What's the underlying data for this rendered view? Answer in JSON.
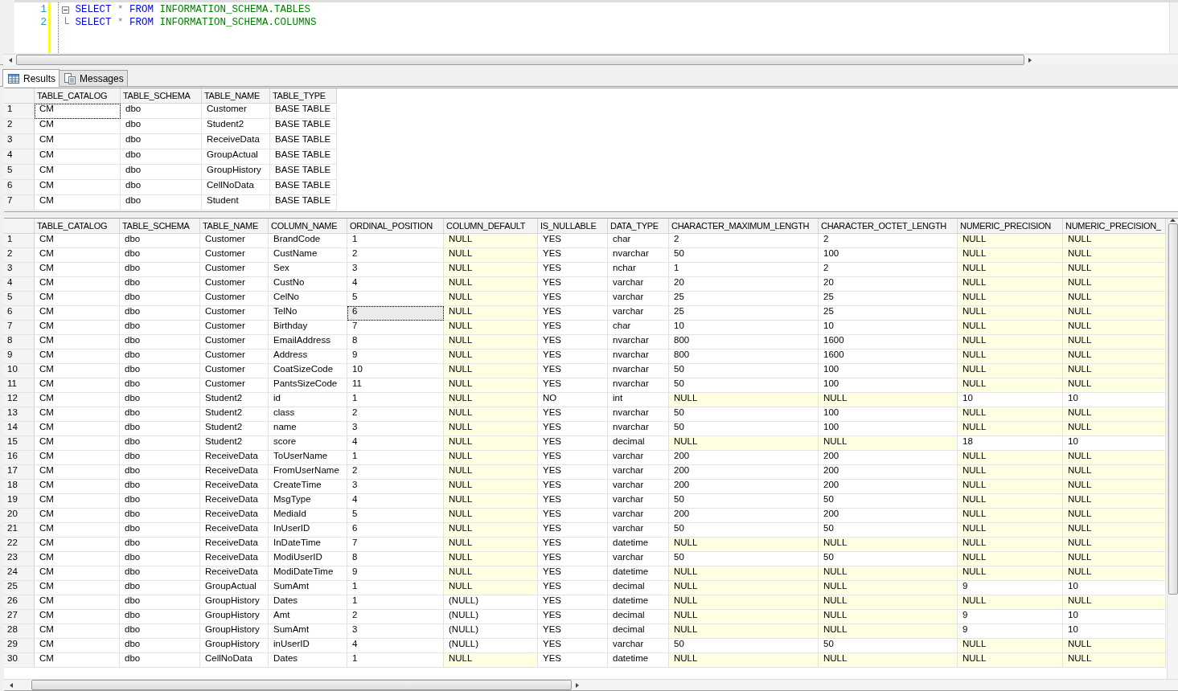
{
  "editor": {
    "lines": [
      {
        "number": "1",
        "fold_start": true,
        "tokens": [
          {
            "kind": "keyword",
            "text": "SELECT"
          },
          {
            "kind": "operator",
            "text": "*"
          },
          {
            "kind": "keyword",
            "text": "FROM"
          },
          {
            "kind": "identifier",
            "text": "INFORMATION_SCHEMA.TABLES"
          }
        ]
      },
      {
        "number": "2",
        "fold_start": false,
        "tokens": [
          {
            "kind": "keyword",
            "text": "SELECT"
          },
          {
            "kind": "operator",
            "text": "*"
          },
          {
            "kind": "keyword",
            "text": "FROM"
          },
          {
            "kind": "identifier",
            "text": "INFORMATION_SCHEMA.COLUMNS"
          }
        ]
      }
    ]
  },
  "tabs": [
    {
      "label": "Results",
      "kind": "grid",
      "selected": true
    },
    {
      "label": "Messages",
      "kind": "messages",
      "selected": false
    }
  ],
  "grids": [
    {
      "columns": [
        "TABLE_CATALOG",
        "TABLE_SCHEMA",
        "TABLE_NAME",
        "TABLE_TYPE"
      ],
      "rows": [
        {
          "number": "1",
          "cells": [
            "CM",
            "dbo",
            "Customer",
            "BASE TABLE"
          ],
          "selected": [
            true,
            false,
            false,
            false
          ]
        },
        {
          "number": "2",
          "cells": [
            "CM",
            "dbo",
            "Student2",
            "BASE TABLE"
          ],
          "selected": [
            false,
            false,
            false,
            false
          ]
        },
        {
          "number": "3",
          "cells": [
            "CM",
            "dbo",
            "ReceiveData",
            "BASE TABLE"
          ],
          "selected": [
            false,
            false,
            false,
            false
          ]
        },
        {
          "number": "4",
          "cells": [
            "CM",
            "dbo",
            "GroupActual",
            "BASE TABLE"
          ],
          "selected": [
            false,
            false,
            false,
            false
          ]
        },
        {
          "number": "5",
          "cells": [
            "CM",
            "dbo",
            "GroupHistory",
            "BASE TABLE"
          ],
          "selected": [
            false,
            false,
            false,
            false
          ]
        },
        {
          "number": "6",
          "cells": [
            "CM",
            "dbo",
            "CellNoData",
            "BASE TABLE"
          ],
          "selected": [
            false,
            false,
            false,
            false
          ]
        },
        {
          "number": "7",
          "cells": [
            "CM",
            "dbo",
            "Student",
            "BASE TABLE"
          ],
          "selected": [
            false,
            false,
            false,
            false
          ]
        }
      ]
    },
    {
      "columns": [
        "TABLE_CATALOG",
        "TABLE_SCHEMA",
        "TABLE_NAME",
        "COLUMN_NAME",
        "ORDINAL_POSITION",
        "COLUMN_DEFAULT",
        "IS_NULLABLE",
        "DATA_TYPE",
        "CHARACTER_MAXIMUM_LENGTH",
        "CHARACTER_OCTET_LENGTH",
        "NUMERIC_PRECISION",
        "NUMERIC_PRECISION_"
      ],
      "rows": [
        {
          "number": "1",
          "cells": [
            "CM",
            "dbo",
            "Customer",
            "BrandCode",
            "1",
            "NULL",
            "YES",
            "char",
            "2",
            "2",
            "NULL",
            "NULL"
          ],
          "null": [
            false,
            false,
            false,
            false,
            false,
            true,
            false,
            false,
            false,
            false,
            true,
            true
          ],
          "selected": [
            false,
            false,
            false,
            false,
            false,
            false,
            false,
            false,
            false,
            false,
            false,
            false
          ]
        },
        {
          "number": "2",
          "cells": [
            "CM",
            "dbo",
            "Customer",
            "CustName",
            "2",
            "NULL",
            "YES",
            "nvarchar",
            "50",
            "100",
            "NULL",
            "NULL"
          ],
          "null": [
            false,
            false,
            false,
            false,
            false,
            true,
            false,
            false,
            false,
            false,
            true,
            true
          ],
          "selected": [
            false,
            false,
            false,
            false,
            false,
            false,
            false,
            false,
            false,
            false,
            false,
            false
          ]
        },
        {
          "number": "3",
          "cells": [
            "CM",
            "dbo",
            "Customer",
            "Sex",
            "3",
            "NULL",
            "YES",
            "nchar",
            "1",
            "2",
            "NULL",
            "NULL"
          ],
          "null": [
            false,
            false,
            false,
            false,
            false,
            true,
            false,
            false,
            false,
            false,
            true,
            true
          ],
          "selected": [
            false,
            false,
            false,
            false,
            false,
            false,
            false,
            false,
            false,
            false,
            false,
            false
          ]
        },
        {
          "number": "4",
          "cells": [
            "CM",
            "dbo",
            "Customer",
            "CustNo",
            "4",
            "NULL",
            "YES",
            "varchar",
            "20",
            "20",
            "NULL",
            "NULL"
          ],
          "null": [
            false,
            false,
            false,
            false,
            false,
            true,
            false,
            false,
            false,
            false,
            true,
            true
          ],
          "selected": [
            false,
            false,
            false,
            false,
            false,
            false,
            false,
            false,
            false,
            false,
            false,
            false
          ]
        },
        {
          "number": "5",
          "cells": [
            "CM",
            "dbo",
            "Customer",
            "CelNo",
            "5",
            "NULL",
            "YES",
            "varchar",
            "25",
            "25",
            "NULL",
            "NULL"
          ],
          "null": [
            false,
            false,
            false,
            false,
            false,
            true,
            false,
            false,
            false,
            false,
            true,
            true
          ],
          "selected": [
            false,
            false,
            false,
            false,
            false,
            false,
            false,
            false,
            false,
            false,
            false,
            false
          ]
        },
        {
          "number": "6",
          "cells": [
            "CM",
            "dbo",
            "Customer",
            "TelNo",
            "6",
            "NULL",
            "YES",
            "varchar",
            "25",
            "25",
            "NULL",
            "NULL"
          ],
          "null": [
            false,
            false,
            false,
            false,
            false,
            true,
            false,
            false,
            false,
            false,
            true,
            true
          ],
          "selected": [
            false,
            false,
            false,
            false,
            true,
            false,
            false,
            false,
            false,
            false,
            false,
            false
          ]
        },
        {
          "number": "7",
          "cells": [
            "CM",
            "dbo",
            "Customer",
            "Birthday",
            "7",
            "NULL",
            "YES",
            "char",
            "10",
            "10",
            "NULL",
            "NULL"
          ],
          "null": [
            false,
            false,
            false,
            false,
            false,
            true,
            false,
            false,
            false,
            false,
            true,
            true
          ],
          "selected": [
            false,
            false,
            false,
            false,
            false,
            false,
            false,
            false,
            false,
            false,
            false,
            false
          ]
        },
        {
          "number": "8",
          "cells": [
            "CM",
            "dbo",
            "Customer",
            "EmailAddress",
            "8",
            "NULL",
            "YES",
            "nvarchar",
            "800",
            "1600",
            "NULL",
            "NULL"
          ],
          "null": [
            false,
            false,
            false,
            false,
            false,
            true,
            false,
            false,
            false,
            false,
            true,
            true
          ],
          "selected": [
            false,
            false,
            false,
            false,
            false,
            false,
            false,
            false,
            false,
            false,
            false,
            false
          ]
        },
        {
          "number": "9",
          "cells": [
            "CM",
            "dbo",
            "Customer",
            "Address",
            "9",
            "NULL",
            "YES",
            "nvarchar",
            "800",
            "1600",
            "NULL",
            "NULL"
          ],
          "null": [
            false,
            false,
            false,
            false,
            false,
            true,
            false,
            false,
            false,
            false,
            true,
            true
          ],
          "selected": [
            false,
            false,
            false,
            false,
            false,
            false,
            false,
            false,
            false,
            false,
            false,
            false
          ]
        },
        {
          "number": "10",
          "cells": [
            "CM",
            "dbo",
            "Customer",
            "CoatSizeCode",
            "10",
            "NULL",
            "YES",
            "nvarchar",
            "50",
            "100",
            "NULL",
            "NULL"
          ],
          "null": [
            false,
            false,
            false,
            false,
            false,
            true,
            false,
            false,
            false,
            false,
            true,
            true
          ],
          "selected": [
            false,
            false,
            false,
            false,
            false,
            false,
            false,
            false,
            false,
            false,
            false,
            false
          ]
        },
        {
          "number": "11",
          "cells": [
            "CM",
            "dbo",
            "Customer",
            "PantsSizeCode",
            "11",
            "NULL",
            "YES",
            "nvarchar",
            "50",
            "100",
            "NULL",
            "NULL"
          ],
          "null": [
            false,
            false,
            false,
            false,
            false,
            true,
            false,
            false,
            false,
            false,
            true,
            true
          ],
          "selected": [
            false,
            false,
            false,
            false,
            false,
            false,
            false,
            false,
            false,
            false,
            false,
            false
          ]
        },
        {
          "number": "12",
          "cells": [
            "CM",
            "dbo",
            "Student2",
            "id",
            "1",
            "NULL",
            "NO",
            "int",
            "NULL",
            "NULL",
            "10",
            "10"
          ],
          "null": [
            false,
            false,
            false,
            false,
            false,
            true,
            false,
            false,
            true,
            true,
            false,
            false
          ],
          "selected": [
            false,
            false,
            false,
            false,
            false,
            false,
            false,
            false,
            false,
            false,
            false,
            false
          ]
        },
        {
          "number": "13",
          "cells": [
            "CM",
            "dbo",
            "Student2",
            "class",
            "2",
            "NULL",
            "YES",
            "nvarchar",
            "50",
            "100",
            "NULL",
            "NULL"
          ],
          "null": [
            false,
            false,
            false,
            false,
            false,
            true,
            false,
            false,
            false,
            false,
            true,
            true
          ],
          "selected": [
            false,
            false,
            false,
            false,
            false,
            false,
            false,
            false,
            false,
            false,
            false,
            false
          ]
        },
        {
          "number": "14",
          "cells": [
            "CM",
            "dbo",
            "Student2",
            "name",
            "3",
            "NULL",
            "YES",
            "nvarchar",
            "50",
            "100",
            "NULL",
            "NULL"
          ],
          "null": [
            false,
            false,
            false,
            false,
            false,
            true,
            false,
            false,
            false,
            false,
            true,
            true
          ],
          "selected": [
            false,
            false,
            false,
            false,
            false,
            false,
            false,
            false,
            false,
            false,
            false,
            false
          ]
        },
        {
          "number": "15",
          "cells": [
            "CM",
            "dbo",
            "Student2",
            "score",
            "4",
            "NULL",
            "YES",
            "decimal",
            "NULL",
            "NULL",
            "18",
            "10"
          ],
          "null": [
            false,
            false,
            false,
            false,
            false,
            true,
            false,
            false,
            true,
            true,
            false,
            false
          ],
          "selected": [
            false,
            false,
            false,
            false,
            false,
            false,
            false,
            false,
            false,
            false,
            false,
            false
          ]
        },
        {
          "number": "16",
          "cells": [
            "CM",
            "dbo",
            "ReceiveData",
            "ToUserName",
            "1",
            "NULL",
            "YES",
            "varchar",
            "200",
            "200",
            "NULL",
            "NULL"
          ],
          "null": [
            false,
            false,
            false,
            false,
            false,
            true,
            false,
            false,
            false,
            false,
            true,
            true
          ],
          "selected": [
            false,
            false,
            false,
            false,
            false,
            false,
            false,
            false,
            false,
            false,
            false,
            false
          ]
        },
        {
          "number": "17",
          "cells": [
            "CM",
            "dbo",
            "ReceiveData",
            "FromUserName",
            "2",
            "NULL",
            "YES",
            "varchar",
            "200",
            "200",
            "NULL",
            "NULL"
          ],
          "null": [
            false,
            false,
            false,
            false,
            false,
            true,
            false,
            false,
            false,
            false,
            true,
            true
          ],
          "selected": [
            false,
            false,
            false,
            false,
            false,
            false,
            false,
            false,
            false,
            false,
            false,
            false
          ]
        },
        {
          "number": "18",
          "cells": [
            "CM",
            "dbo",
            "ReceiveData",
            "CreateTime",
            "3",
            "NULL",
            "YES",
            "varchar",
            "200",
            "200",
            "NULL",
            "NULL"
          ],
          "null": [
            false,
            false,
            false,
            false,
            false,
            true,
            false,
            false,
            false,
            false,
            true,
            true
          ],
          "selected": [
            false,
            false,
            false,
            false,
            false,
            false,
            false,
            false,
            false,
            false,
            false,
            false
          ]
        },
        {
          "number": "19",
          "cells": [
            "CM",
            "dbo",
            "ReceiveData",
            "MsgType",
            "4",
            "NULL",
            "YES",
            "varchar",
            "50",
            "50",
            "NULL",
            "NULL"
          ],
          "null": [
            false,
            false,
            false,
            false,
            false,
            true,
            false,
            false,
            false,
            false,
            true,
            true
          ],
          "selected": [
            false,
            false,
            false,
            false,
            false,
            false,
            false,
            false,
            false,
            false,
            false,
            false
          ]
        },
        {
          "number": "20",
          "cells": [
            "CM",
            "dbo",
            "ReceiveData",
            "MediaId",
            "5",
            "NULL",
            "YES",
            "varchar",
            "200",
            "200",
            "NULL",
            "NULL"
          ],
          "null": [
            false,
            false,
            false,
            false,
            false,
            true,
            false,
            false,
            false,
            false,
            true,
            true
          ],
          "selected": [
            false,
            false,
            false,
            false,
            false,
            false,
            false,
            false,
            false,
            false,
            false,
            false
          ]
        },
        {
          "number": "21",
          "cells": [
            "CM",
            "dbo",
            "ReceiveData",
            "InUserID",
            "6",
            "NULL",
            "YES",
            "varchar",
            "50",
            "50",
            "NULL",
            "NULL"
          ],
          "null": [
            false,
            false,
            false,
            false,
            false,
            true,
            false,
            false,
            false,
            false,
            true,
            true
          ],
          "selected": [
            false,
            false,
            false,
            false,
            false,
            false,
            false,
            false,
            false,
            false,
            false,
            false
          ]
        },
        {
          "number": "22",
          "cells": [
            "CM",
            "dbo",
            "ReceiveData",
            "InDateTime",
            "7",
            "NULL",
            "YES",
            "datetime",
            "NULL",
            "NULL",
            "NULL",
            "NULL"
          ],
          "null": [
            false,
            false,
            false,
            false,
            false,
            true,
            false,
            false,
            true,
            true,
            true,
            true
          ],
          "selected": [
            false,
            false,
            false,
            false,
            false,
            false,
            false,
            false,
            false,
            false,
            false,
            false
          ]
        },
        {
          "number": "23",
          "cells": [
            "CM",
            "dbo",
            "ReceiveData",
            "ModiUserID",
            "8",
            "NULL",
            "YES",
            "varchar",
            "50",
            "50",
            "NULL",
            "NULL"
          ],
          "null": [
            false,
            false,
            false,
            false,
            false,
            true,
            false,
            false,
            false,
            false,
            true,
            true
          ],
          "selected": [
            false,
            false,
            false,
            false,
            false,
            false,
            false,
            false,
            false,
            false,
            false,
            false
          ]
        },
        {
          "number": "24",
          "cells": [
            "CM",
            "dbo",
            "ReceiveData",
            "ModiDateTime",
            "9",
            "NULL",
            "YES",
            "datetime",
            "NULL",
            "NULL",
            "NULL",
            "NULL"
          ],
          "null": [
            false,
            false,
            false,
            false,
            false,
            true,
            false,
            false,
            true,
            true,
            true,
            true
          ],
          "selected": [
            false,
            false,
            false,
            false,
            false,
            false,
            false,
            false,
            false,
            false,
            false,
            false
          ]
        },
        {
          "number": "25",
          "cells": [
            "CM",
            "dbo",
            "GroupActual",
            "SumAmt",
            "1",
            "NULL",
            "YES",
            "decimal",
            "NULL",
            "NULL",
            "9",
            "10"
          ],
          "null": [
            false,
            false,
            false,
            false,
            false,
            true,
            false,
            false,
            true,
            true,
            false,
            false
          ],
          "selected": [
            false,
            false,
            false,
            false,
            false,
            false,
            false,
            false,
            false,
            false,
            false,
            false
          ]
        },
        {
          "number": "26",
          "cells": [
            "CM",
            "dbo",
            "GroupHistory",
            "Dates",
            "1",
            "(NULL)",
            "YES",
            "datetime",
            "NULL",
            "NULL",
            "NULL",
            "NULL"
          ],
          "null": [
            false,
            false,
            false,
            false,
            false,
            false,
            false,
            false,
            true,
            true,
            true,
            true
          ],
          "selected": [
            false,
            false,
            false,
            false,
            false,
            false,
            false,
            false,
            false,
            false,
            false,
            false
          ]
        },
        {
          "number": "27",
          "cells": [
            "CM",
            "dbo",
            "GroupHistory",
            "Amt",
            "2",
            "(NULL)",
            "YES",
            "decimal",
            "NULL",
            "NULL",
            "9",
            "10"
          ],
          "null": [
            false,
            false,
            false,
            false,
            false,
            false,
            false,
            false,
            true,
            true,
            false,
            false
          ],
          "selected": [
            false,
            false,
            false,
            false,
            false,
            false,
            false,
            false,
            false,
            false,
            false,
            false
          ]
        },
        {
          "number": "28",
          "cells": [
            "CM",
            "dbo",
            "GroupHistory",
            "SumAmt",
            "3",
            "(NULL)",
            "YES",
            "decimal",
            "NULL",
            "NULL",
            "9",
            "10"
          ],
          "null": [
            false,
            false,
            false,
            false,
            false,
            false,
            false,
            false,
            true,
            true,
            false,
            false
          ],
          "selected": [
            false,
            false,
            false,
            false,
            false,
            false,
            false,
            false,
            false,
            false,
            false,
            false
          ]
        },
        {
          "number": "29",
          "cells": [
            "CM",
            "dbo",
            "GroupHistory",
            "inUserID",
            "4",
            "(NULL)",
            "YES",
            "varchar",
            "50",
            "50",
            "NULL",
            "NULL"
          ],
          "null": [
            false,
            false,
            false,
            false,
            false,
            false,
            false,
            false,
            false,
            false,
            true,
            true
          ],
          "selected": [
            false,
            false,
            false,
            false,
            false,
            false,
            false,
            false,
            false,
            false,
            false,
            false
          ]
        },
        {
          "number": "30",
          "cells": [
            "CM",
            "dbo",
            "CellNoData",
            "Dates",
            "1",
            "NULL",
            "YES",
            "datetime",
            "NULL",
            "NULL",
            "NULL",
            "NULL"
          ],
          "null": [
            false,
            false,
            false,
            false,
            false,
            true,
            false,
            false,
            true,
            true,
            true,
            true
          ],
          "selected": [
            false,
            false,
            false,
            false,
            false,
            false,
            false,
            false,
            false,
            false,
            false,
            false
          ]
        }
      ]
    }
  ]
}
